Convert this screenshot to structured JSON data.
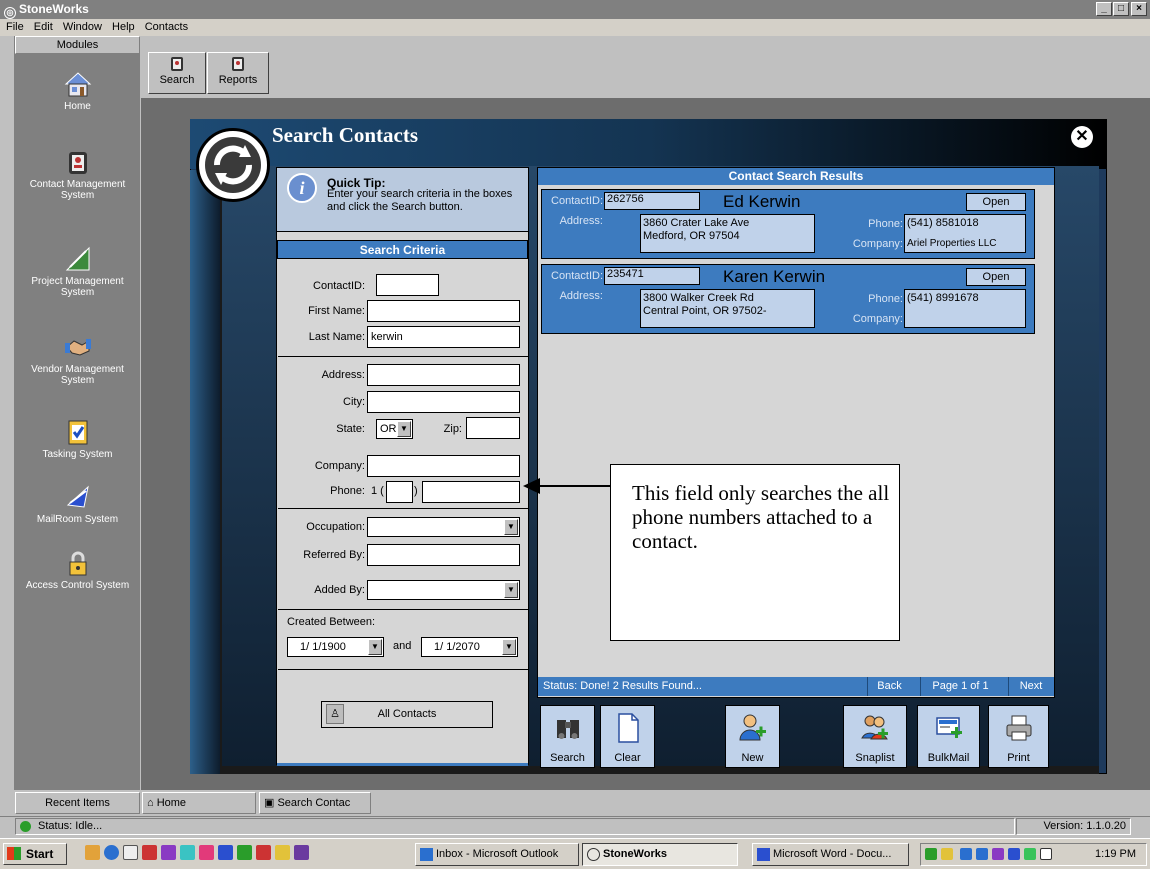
{
  "app": {
    "title": "StoneWorks",
    "window_controls": [
      "_",
      "□",
      "×"
    ]
  },
  "menu": [
    "File",
    "Edit",
    "Window",
    "Help",
    "Contacts"
  ],
  "sidebar": {
    "header": "Modules",
    "items": [
      {
        "label": "Home",
        "icon": "home-icon"
      },
      {
        "label": "Contact Management System",
        "icon": "contact-icon"
      },
      {
        "label": "Project Management System",
        "icon": "project-icon"
      },
      {
        "label": "Vendor Management System",
        "icon": "handshake-icon"
      },
      {
        "label": "Tasking System",
        "icon": "checklist-icon"
      },
      {
        "label": "MailRoom System",
        "icon": "mail-icon"
      },
      {
        "label": "Access Control System",
        "icon": "lock-icon"
      }
    ]
  },
  "toolbar": {
    "search_label": "Search",
    "reports_label": "Reports"
  },
  "search_window": {
    "title": "Search Contacts",
    "tip": {
      "title": "Quick Tip:",
      "text": "Enter your search criteria in the boxes and click the Search button."
    },
    "criteria": {
      "header": "Search Criteria",
      "contact_id_label": "ContactID:",
      "contact_id_value": "",
      "first_name_label": "First Name:",
      "first_name_value": "",
      "last_name_label": "Last Name:",
      "last_name_value": "kerwin",
      "address_label": "Address:",
      "address_value": "",
      "city_label": "City:",
      "city_value": "",
      "state_label": "State:",
      "state_value": "OR",
      "zip_label": "Zip:",
      "zip_value": "",
      "company_label": "Company:",
      "company_value": "",
      "phone_label": "Phone:",
      "phone_prefix": "1 (",
      "phone_mid": ")",
      "occupation_label": "Occupation:",
      "occupation_value": "",
      "referred_label": "Referred By:",
      "referred_value": "",
      "added_by_label": "Added By:",
      "added_by_value": "",
      "created_label": "Created Between:",
      "created_from": "1/ 1/1900",
      "and_label": "and",
      "created_to": "1/ 1/2070"
    },
    "all_contacts_label": "All Contacts",
    "results": {
      "header": "Contact Search Results",
      "cards": [
        {
          "contact_id_label": "ContactID:",
          "contact_id": "262756",
          "name": "Ed Kerwin",
          "open_label": "Open",
          "address_label": "Address:",
          "address1": "3860 Crater Lake Ave",
          "address2": "Medford, OR 97504",
          "phone_label": "Phone:",
          "phone": "(541) 8581018",
          "company_label": "Company:",
          "company": "Ariel Properties LLC"
        },
        {
          "contact_id_label": "ContactID:",
          "contact_id": "235471",
          "name": "Karen Kerwin",
          "open_label": "Open",
          "address_label": "Address:",
          "address1": "3800 Walker Creek Rd",
          "address2": "Central Point, OR 97502-",
          "phone_label": "Phone:",
          "phone": "(541) 8991678",
          "company_label": "Company:",
          "company": ""
        }
      ],
      "status": "Status: Done! 2 Results Found...",
      "back_label": "Back",
      "page_label": "Page 1 of 1",
      "next_label": "Next"
    },
    "actions": [
      {
        "label": "Search",
        "icon": "binoculars-icon"
      },
      {
        "label": "Clear",
        "icon": "blank-page-icon"
      },
      {
        "label": "New",
        "icon": "add-user-icon"
      },
      {
        "label": "Snaplist",
        "icon": "snaplist-icon"
      },
      {
        "label": "BulkMail",
        "icon": "bulkmail-icon"
      },
      {
        "label": "Print",
        "icon": "printer-icon"
      }
    ]
  },
  "callout": "This field only searches the all phone numbers attached to a contact.",
  "bottom_tabs": {
    "recent": "Recent Items",
    "home": "Home",
    "search": "Search Contac"
  },
  "status": {
    "left": "Status: Idle...",
    "version": "Version: 1.1.0.20"
  },
  "taskbar": {
    "start": "Start",
    "tasks": [
      "Inbox - Microsoft Outlook",
      "StoneWorks",
      "Microsoft Word - Docu..."
    ],
    "clock": "1:19 PM"
  }
}
